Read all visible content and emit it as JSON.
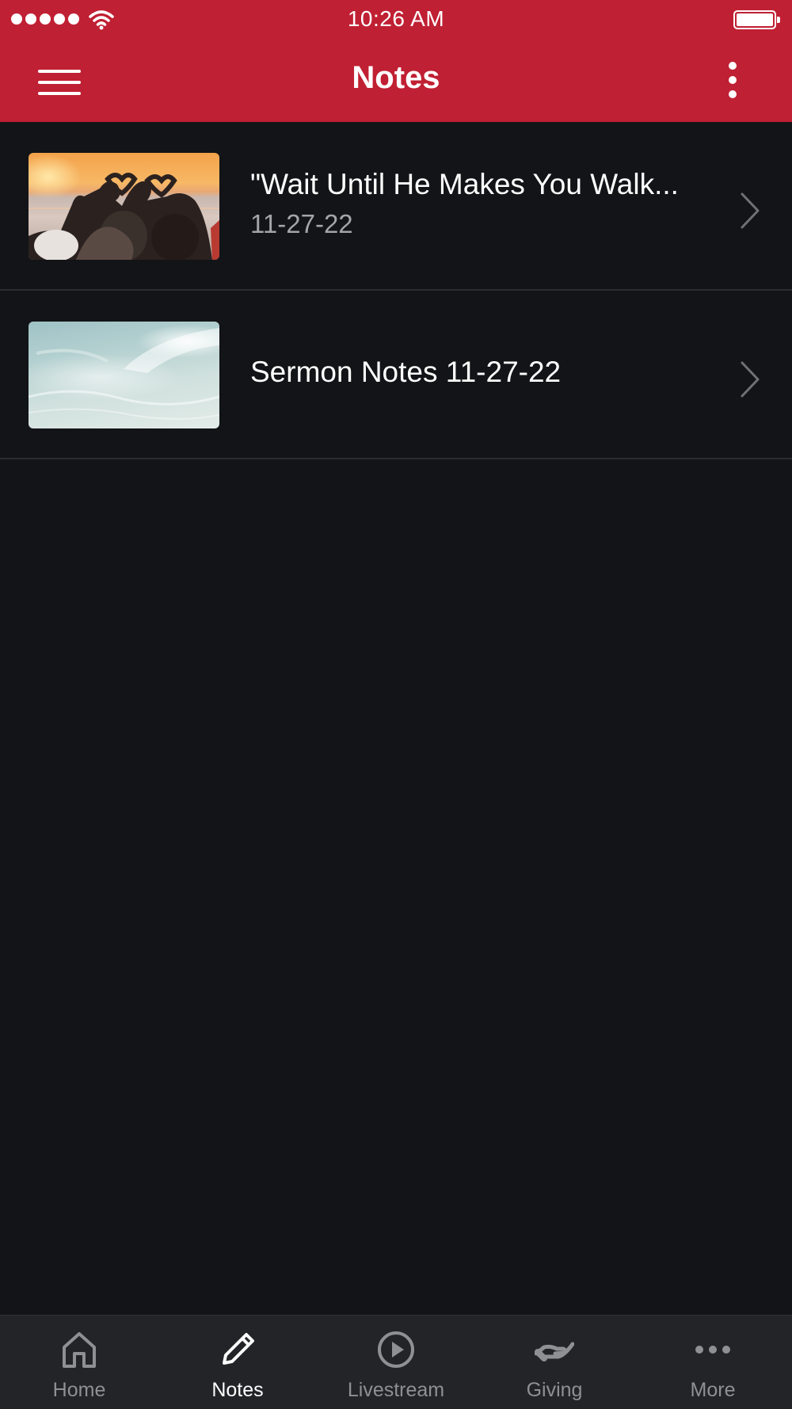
{
  "status_bar": {
    "time": "10:26 AM"
  },
  "header": {
    "title": "Notes"
  },
  "notes": [
    {
      "title": "\"Wait Until He Makes You Walk...",
      "date": "11-27-22",
      "thumbnail": "sunset-friends-heart-hands"
    },
    {
      "title": "Sermon Notes 11-27-22",
      "date": "",
      "thumbnail": "ocean-wave"
    }
  ],
  "tab_bar": {
    "active": "Notes",
    "tabs": [
      {
        "label": "Home",
        "icon": "home-icon"
      },
      {
        "label": "Notes",
        "icon": "pencil-icon"
      },
      {
        "label": "Livestream",
        "icon": "play-circle-icon"
      },
      {
        "label": "Giving",
        "icon": "giving-hand-icon"
      },
      {
        "label": "More",
        "icon": "ellipsis-icon"
      }
    ]
  },
  "colors": {
    "brand": "#c02033",
    "background": "#131417",
    "tab_bar": "#232427",
    "muted_text": "#a3a5aa"
  }
}
